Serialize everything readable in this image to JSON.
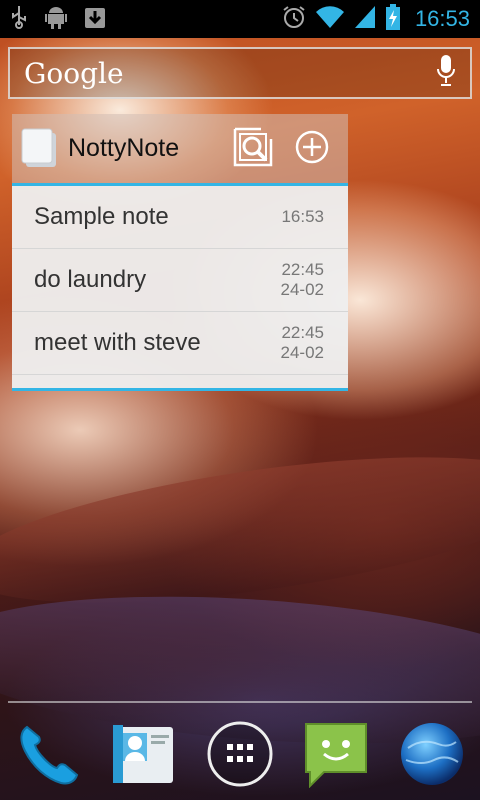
{
  "statusbar": {
    "time": "16:53",
    "icons": [
      "usb-icon",
      "android-debug-icon",
      "download-icon",
      "alarm-icon",
      "wifi-icon",
      "signal-icon",
      "battery-charging-icon"
    ]
  },
  "search": {
    "logo": "Google",
    "mic_icon": "mic-icon"
  },
  "widget": {
    "title": "NottyNote",
    "actions": [
      "search-notes-icon",
      "add-note-icon"
    ],
    "notes": [
      {
        "title": "Sample note",
        "time": "16:53",
        "date": ""
      },
      {
        "title": "do laundry",
        "time": "22:45",
        "date": "24-02"
      },
      {
        "title": "meet with steve",
        "time": "22:45",
        "date": "24-02"
      }
    ]
  },
  "dock": {
    "items": [
      "phone-icon",
      "contacts-icon",
      "all-apps-icon",
      "messaging-icon",
      "browser-globe-icon"
    ]
  },
  "colors": {
    "accent": "#33b5e5"
  }
}
